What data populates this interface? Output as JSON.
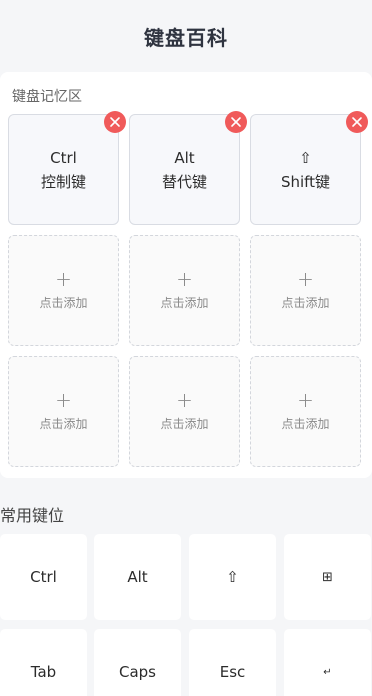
{
  "header": {
    "title": "键盘百科"
  },
  "memory": {
    "title": "键盘记忆区",
    "filled": [
      {
        "name": "Ctrl",
        "desc": "控制键"
      },
      {
        "name": "Alt",
        "desc": "替代键"
      },
      {
        "name": "⇧",
        "desc": "Shift键"
      }
    ],
    "empty_plus": "+",
    "empty_label": "点击添加"
  },
  "common": {
    "title": "常用键位",
    "keys": [
      "Ctrl",
      "Alt",
      "⇧",
      "⊞",
      "Tab",
      "Caps",
      "Esc",
      "↵"
    ]
  },
  "colors": {
    "remove": "#f05a5a",
    "background": "#f5f6f8"
  }
}
